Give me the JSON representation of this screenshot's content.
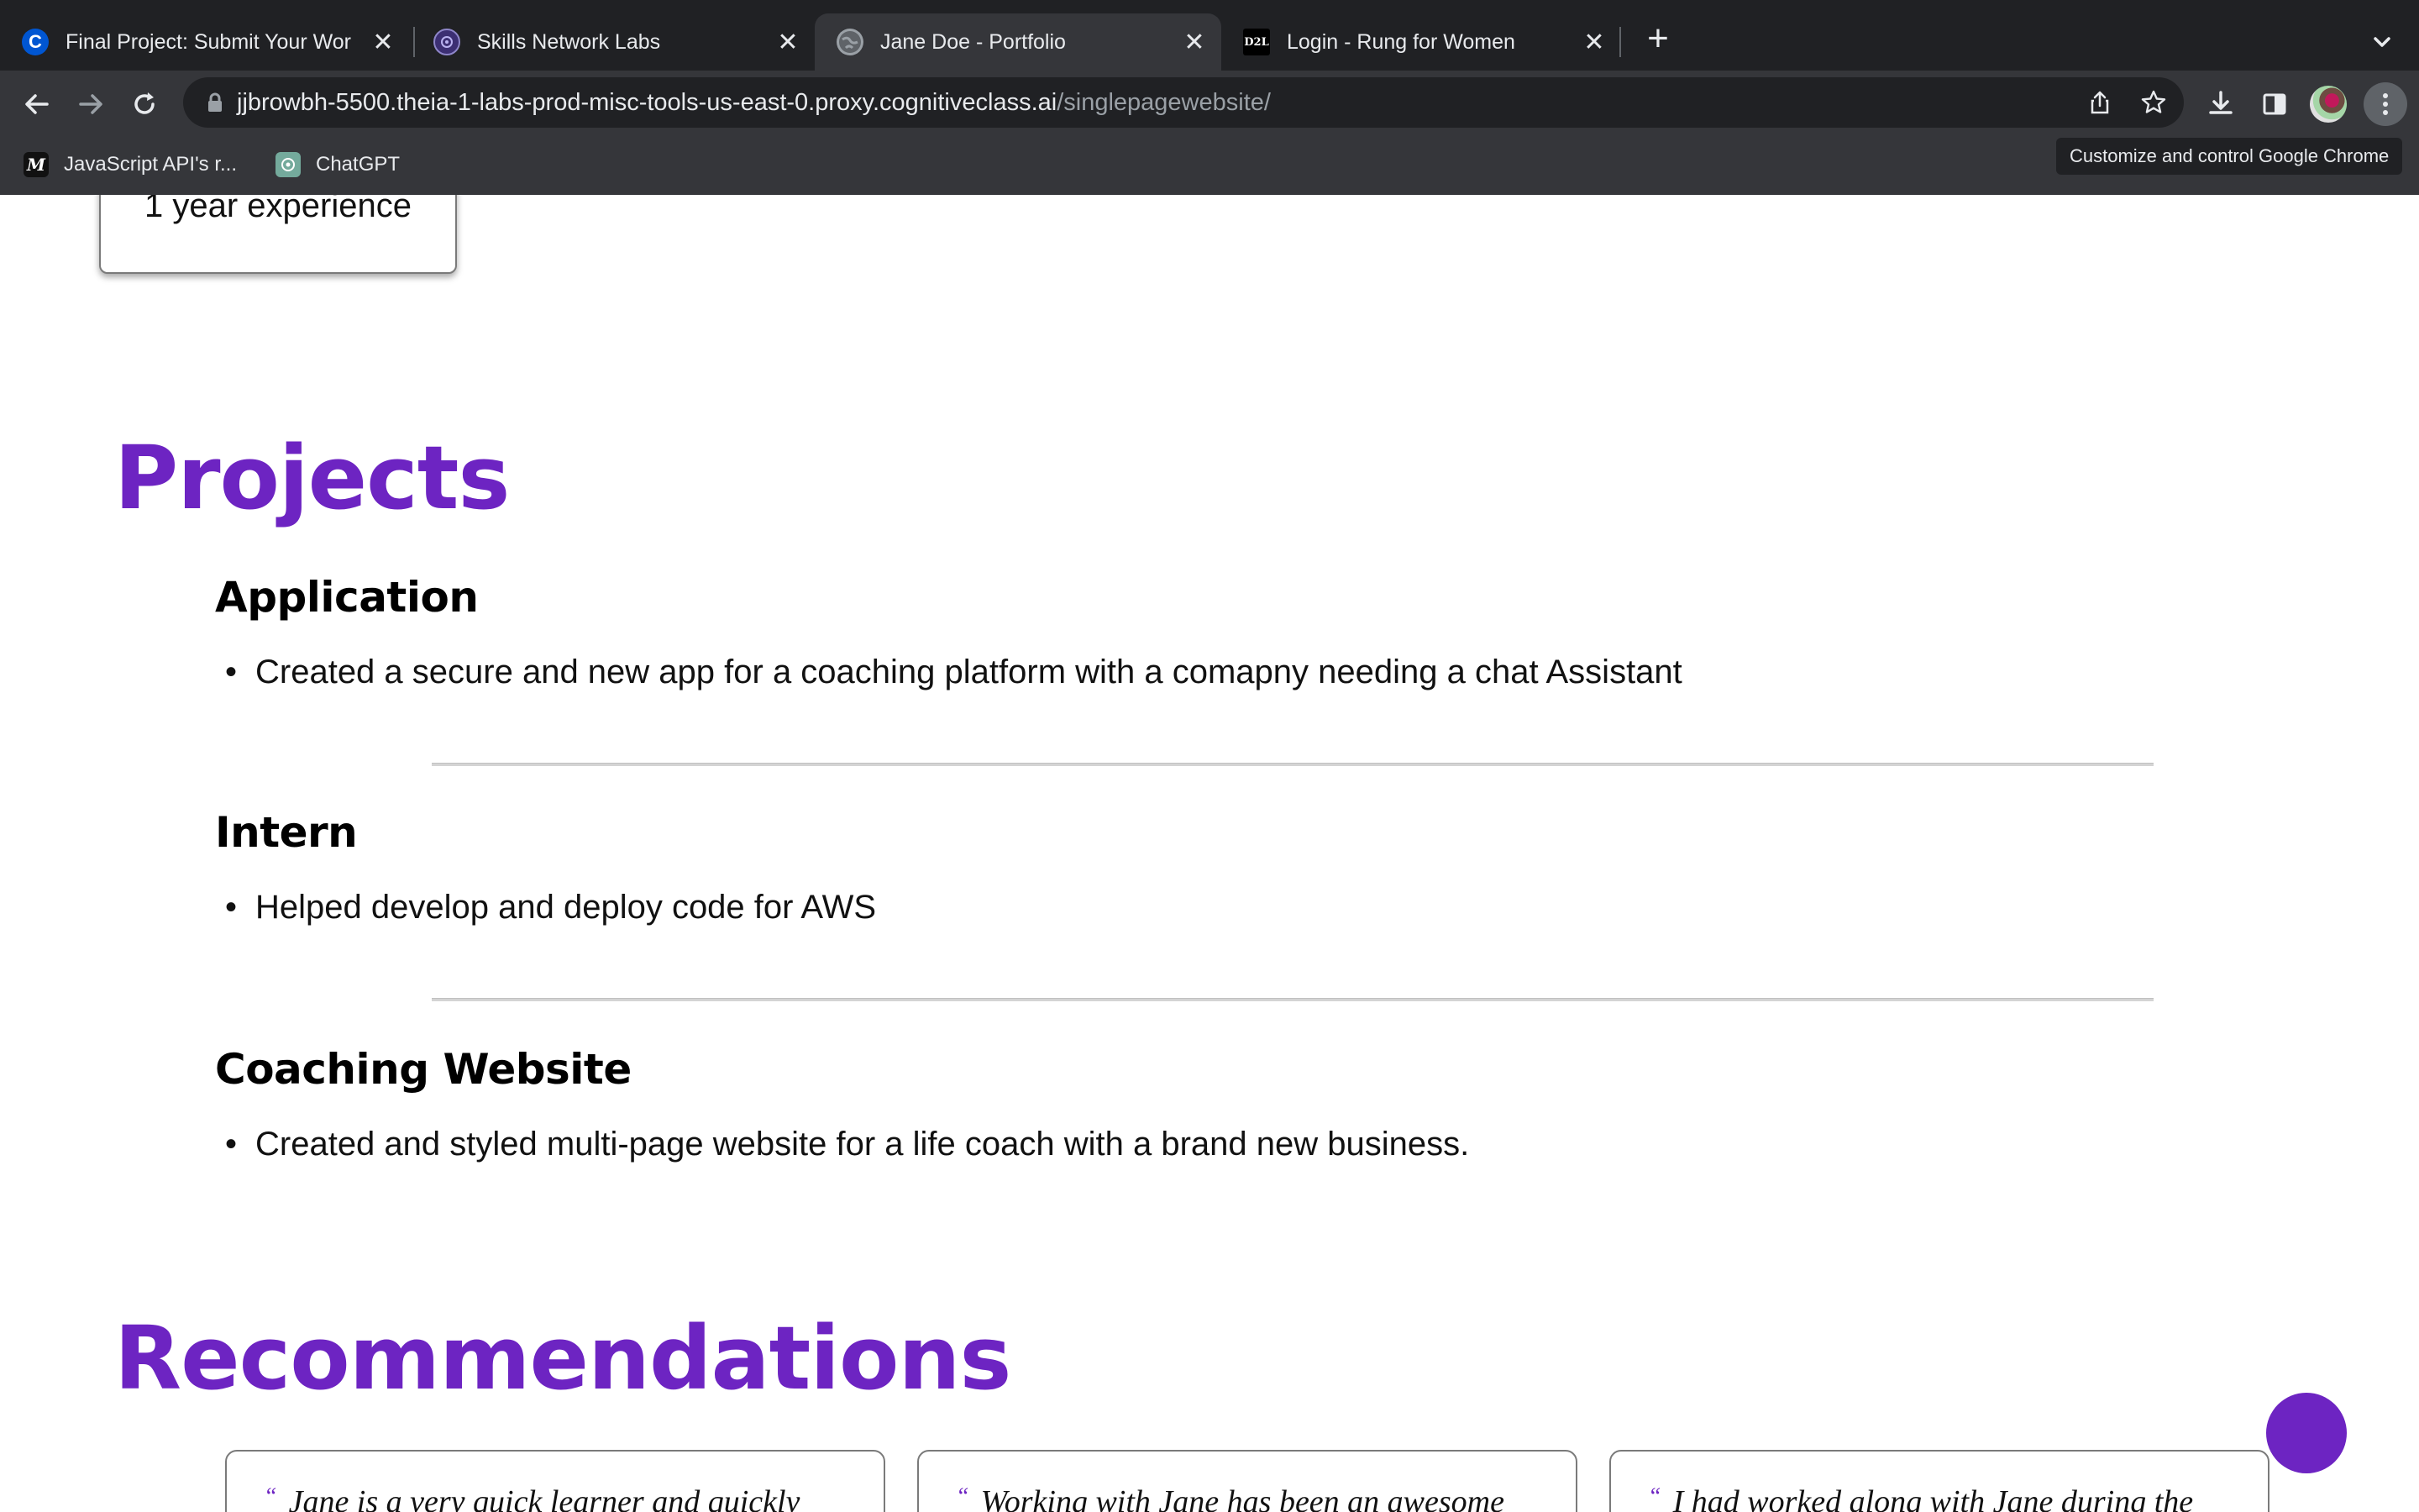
{
  "browser": {
    "tabs": [
      {
        "title": "Final Project: Submit Your Wor",
        "favicon": "coursera-icon",
        "active": false
      },
      {
        "title": "Skills Network Labs",
        "favicon": "skills-network-icon",
        "active": false
      },
      {
        "title": "Jane Doe - Portfolio",
        "favicon": "globe-icon",
        "active": true
      },
      {
        "title": "Login - Rung for Women",
        "favicon": "d2l-icon",
        "active": false
      }
    ],
    "close_glyph": "✕",
    "new_tab_glyph": "+",
    "url_host": "jjbrowbh-5500.theia-1-labs-prod-misc-tools-us-east-0.proxy.cognitiveclass.ai",
    "url_path": "/singlepagewebsite/",
    "bookmarks": [
      {
        "label": "JavaScript API's r...",
        "icon": "medium-icon",
        "icon_text": "M"
      },
      {
        "label": "ChatGPT",
        "icon": "chatgpt-icon",
        "icon_text": ""
      }
    ],
    "tooltip": "Customize and control Google Chrome",
    "d2l_favicon_text": "D2L",
    "coursera_favicon_text": "C"
  },
  "page": {
    "skill_card_text": "1 year experience",
    "projects_title": "Projects",
    "projects": [
      {
        "title": "Application",
        "bullet": "Created a secure and new app for a coaching platform with a comapny needing a chat Assistant"
      },
      {
        "title": "Intern",
        "bullet": "Helped develop and deploy code for AWS"
      },
      {
        "title": "Coaching Website",
        "bullet": "Created and styled multi-page website for a life coach with a brand new business."
      }
    ],
    "recommendations_title": "Recommendations",
    "quote_mark": "“",
    "recommendations": [
      {
        "text": "Jane is a very quick learner and quickly"
      },
      {
        "text": "Working with Jane has been an awesome"
      },
      {
        "text": "I had worked along with Jane during the"
      }
    ]
  },
  "colors": {
    "accent_purple": "#6d24c2",
    "chrome_dark": "#202124",
    "chrome_toolbar": "#35363a"
  }
}
